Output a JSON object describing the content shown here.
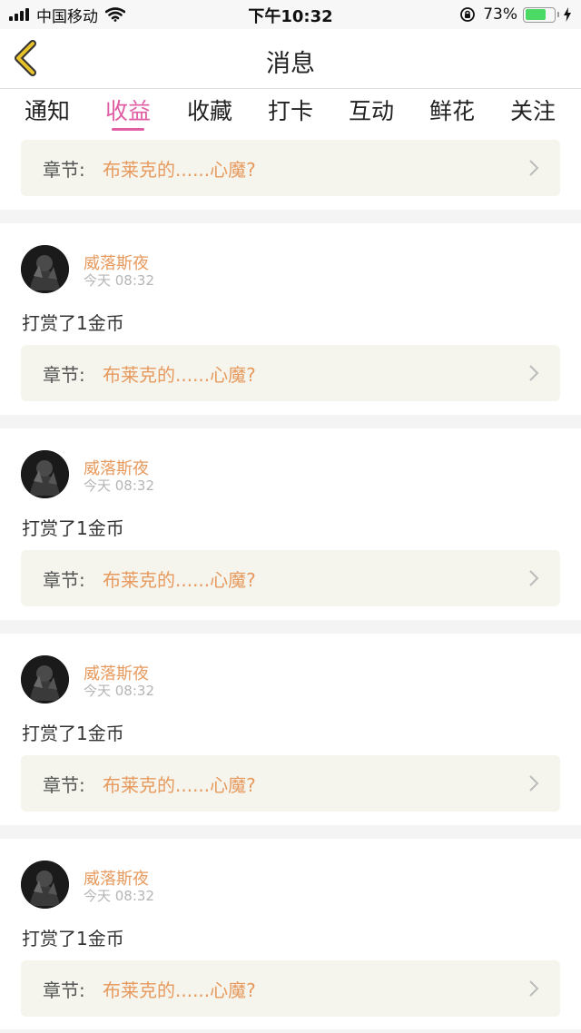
{
  "status_bar": {
    "carrier": "中国移动",
    "time": "下午10:32",
    "battery_percent": "73%",
    "battery_level": 0.73,
    "icons": [
      "signal-icon",
      "wifi-icon",
      "orientation-lock-icon",
      "battery-icon",
      "charging-icon"
    ]
  },
  "nav": {
    "title": "消息",
    "back_icon": "chevron-left-icon"
  },
  "tabs": [
    {
      "label": "通知",
      "active": false
    },
    {
      "label": "收益",
      "active": true
    },
    {
      "label": "收藏",
      "active": false
    },
    {
      "label": "打卡",
      "active": false
    },
    {
      "label": "互动",
      "active": false
    },
    {
      "label": "鲜花",
      "active": false
    },
    {
      "label": "关注",
      "active": false
    }
  ],
  "partial_card": {
    "chapter_prefix": "章节:",
    "chapter_title": "布莱克的......心魔?"
  },
  "messages": [
    {
      "username": "威落斯夜",
      "time": "今天 08:32",
      "text": "打赏了1金币",
      "chapter_prefix": "章节:",
      "chapter_title": "布莱克的......心魔?"
    },
    {
      "username": "威落斯夜",
      "time": "今天 08:32",
      "text": "打赏了1金币",
      "chapter_prefix": "章节:",
      "chapter_title": "布莱克的......心魔?"
    },
    {
      "username": "威落斯夜",
      "time": "今天 08:32",
      "text": "打赏了1金币",
      "chapter_prefix": "章节:",
      "chapter_title": "布莱克的......心魔?"
    },
    {
      "username": "威落斯夜",
      "time": "今天 08:32",
      "text": "打赏了1金币",
      "chapter_prefix": "章节:",
      "chapter_title": "布莱克的......心魔?"
    }
  ],
  "colors": {
    "accent": "#e05da3",
    "username": "#e79a5e",
    "chapter_title": "#e79a5e",
    "card_bg": "#f5f5ee",
    "back_arrow": "#e6c12a",
    "battery": "#4cd964"
  }
}
